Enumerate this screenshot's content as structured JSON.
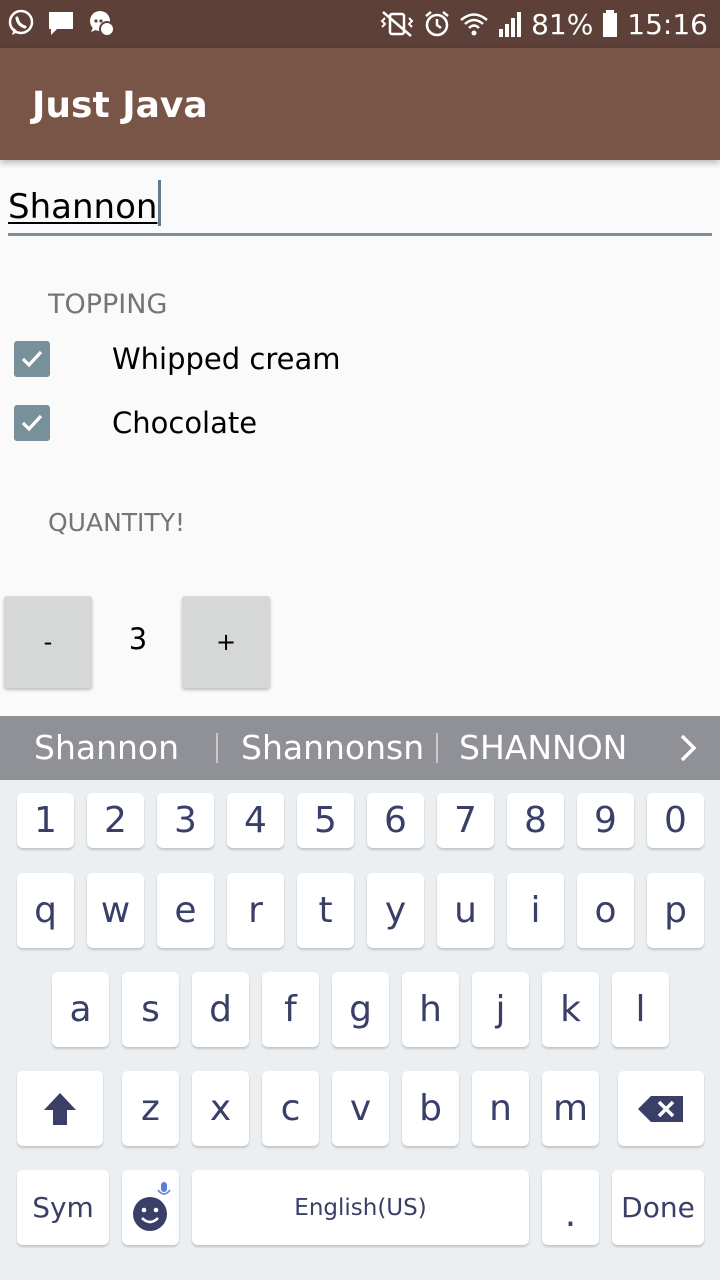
{
  "status_bar": {
    "battery": "81%",
    "time": "15:16",
    "left_icons": [
      "whatsapp-icon",
      "message-icon",
      "chat-icon"
    ],
    "right_icons": [
      "vibrate-mute-icon",
      "alarm-icon",
      "wifi-icon",
      "signal-icon",
      "battery-icon"
    ]
  },
  "app_bar": {
    "title": "Just Java",
    "color": "#795548"
  },
  "name_field": {
    "value": "Shannon"
  },
  "toppings": {
    "heading": "TOPPING",
    "items": [
      {
        "label": "Whipped cream",
        "checked": true
      },
      {
        "label": "Chocolate",
        "checked": true
      }
    ]
  },
  "quantity": {
    "heading": "QUANTITY!",
    "decrement_label": "-",
    "value": "3",
    "increment_label": "+"
  },
  "suggestions": {
    "items": [
      "Shannon",
      "Shannonsn",
      "SHANNON"
    ],
    "more_icon": "chevron-right-icon"
  },
  "keyboard": {
    "number_row": [
      "1",
      "2",
      "3",
      "4",
      "5",
      "6",
      "7",
      "8",
      "9",
      "0"
    ],
    "row1": [
      "q",
      "w",
      "e",
      "r",
      "t",
      "y",
      "u",
      "i",
      "o",
      "p"
    ],
    "row2": [
      "a",
      "s",
      "d",
      "f",
      "g",
      "h",
      "j",
      "k",
      "l"
    ],
    "row3": [
      "z",
      "x",
      "c",
      "v",
      "b",
      "n",
      "m"
    ],
    "sym_label": "Sym",
    "space_label": "English(US)",
    "period_label": ".",
    "done_label": "Done",
    "key_color": "#3a3f68"
  }
}
